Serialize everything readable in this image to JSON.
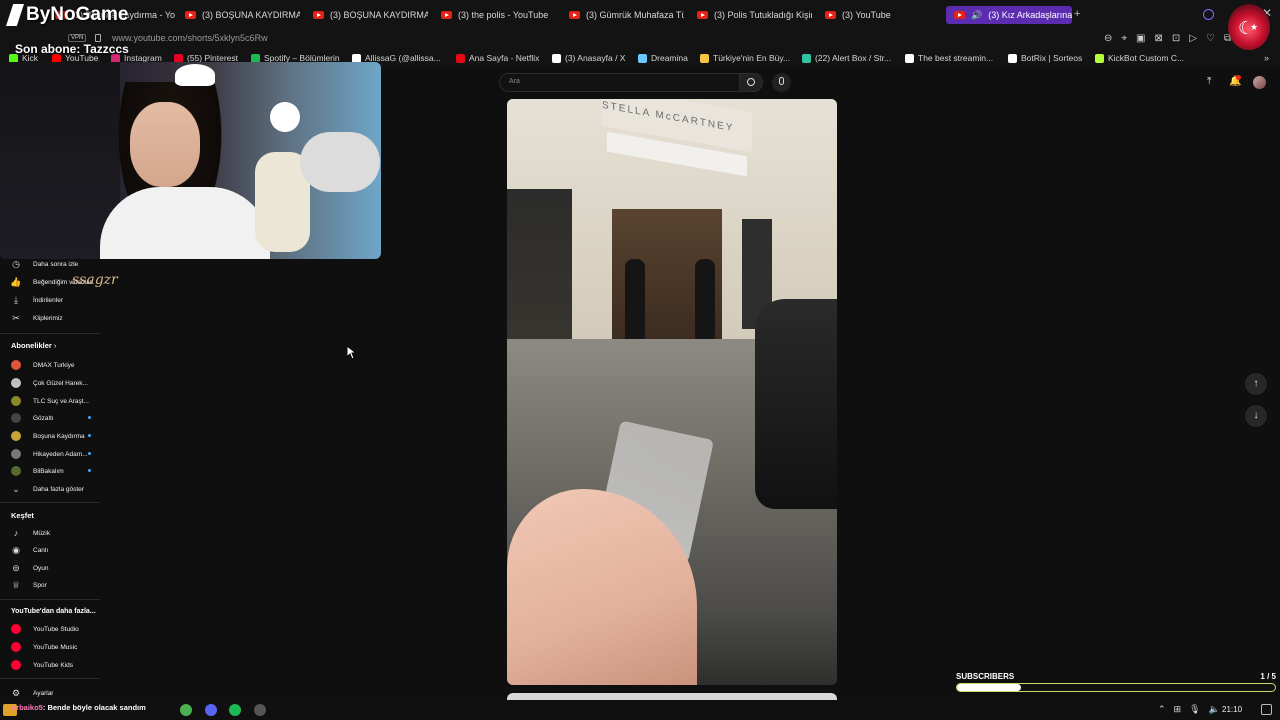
{
  "overlay": {
    "logo_text": "ByNoGame",
    "last_subscriber": "Son abone: Tazzccs",
    "webcam_name_text": "ssagzr",
    "chat_line": {
      "user": "arbaiko5",
      "message": ": Bende böyle olacak sandım"
    },
    "subscribers_goal": {
      "label": "SUBSCRIBERS",
      "count": "1 / 5",
      "progress": 0.2
    }
  },
  "browser": {
    "tabs": [
      {
        "label": "(3) Boşuna Kaydırma - Yo",
        "active": false
      },
      {
        "label": "(3) BOŞUNA KAYDIRMA",
        "active": false
      },
      {
        "label": "(3) BOŞUNA KAYDIRMA",
        "active": false
      },
      {
        "label": "(3) the polis - YouTube",
        "active": false
      },
      {
        "label": "(3) Gümrük Muhafaza Tür",
        "active": false
      },
      {
        "label": "(3) Polis Tutukladığı Kişin",
        "active": false
      },
      {
        "label": "(3) YouTube",
        "active": false
      },
      {
        "label": "(3) Kız Arkadaşlarına",
        "active": true
      }
    ],
    "new_tab": "+",
    "vpn_badge": "VPN",
    "url": "www.youtube.com/shorts/5xklyn5c6Rw",
    "bookmarks": [
      {
        "label": "Kick",
        "color": "#53fc18"
      },
      {
        "label": "YouTube",
        "color": "#ff0000"
      },
      {
        "label": "Instagram",
        "color": "#d62976"
      },
      {
        "label": "(55) Pinterest",
        "color": "#e60023"
      },
      {
        "label": "Spotify – Bölümlerin",
        "color": "#1db954"
      },
      {
        "label": "AllissaG (@allissa...",
        "color": "#ffffff"
      },
      {
        "label": "Ana Sayfa - Netflix",
        "color": "#e50914"
      },
      {
        "label": "(3) Anasayfa / X",
        "color": "#ffffff"
      },
      {
        "label": "Dreamina",
        "color": "#6ac7ff"
      },
      {
        "label": "Türkiye'nin En Büy...",
        "color": "#f5c542"
      },
      {
        "label": "(22) Alert Box / Str...",
        "color": "#31c3a2"
      },
      {
        "label": "The best streamin...",
        "color": "#ffffff"
      },
      {
        "label": "BotRix | Sorteos",
        "color": "#ffffff"
      },
      {
        "label": "KickBot Custom C...",
        "color": "#b6ff3b"
      }
    ]
  },
  "youtube": {
    "search_placeholder": "Ara",
    "nav_items": [
      {
        "label": "Daha sonra izle",
        "icon": "clock-icon"
      },
      {
        "label": "Beğendiğim videolar",
        "icon": "thumbs-up-icon"
      },
      {
        "label": "İndirilenler",
        "icon": "download-icon"
      },
      {
        "label": "Kliplerimiz",
        "icon": "scissors-icon"
      }
    ],
    "subscriptions_title": "Abonelikler",
    "subscriptions": [
      {
        "label": "DMAX Turkiye",
        "color": "#e0553a",
        "dot": false
      },
      {
        "label": "Çok Güzel Harek...",
        "color": "#c0c0c0",
        "dot": false
      },
      {
        "label": "TLC Suç ve Araşt...",
        "color": "#8a8a2a",
        "dot": false
      },
      {
        "label": "Gözaltı",
        "color": "#444444",
        "dot": true
      },
      {
        "label": "Boşuna Kaydırma",
        "color": "#c7a437",
        "dot": true
      },
      {
        "label": "Hikayeden Adam...",
        "color": "#777777",
        "dot": true
      },
      {
        "label": "BilBakalım",
        "color": "#556b2f",
        "dot": true
      }
    ],
    "show_more": "Daha fazla göster",
    "explore_title": "Keşfet",
    "explore": [
      {
        "label": "Müzik",
        "icon": "music-icon"
      },
      {
        "label": "Canlı",
        "icon": "live-icon"
      },
      {
        "label": "Oyun",
        "icon": "gamepad-icon"
      },
      {
        "label": "Spor",
        "icon": "trophy-icon"
      }
    ],
    "more_title": "YouTube'dan daha fazla...",
    "more": [
      {
        "label": "YouTube Studio",
        "color": "#ff0033"
      },
      {
        "label": "YouTube Music",
        "color": "#ff0033"
      },
      {
        "label": "YouTube Kids",
        "color": "#ff0033"
      }
    ],
    "settings": "Ayarlar",
    "store_sign": "STELLA McCARTNEY"
  },
  "taskbar": {
    "time": "21:10"
  }
}
